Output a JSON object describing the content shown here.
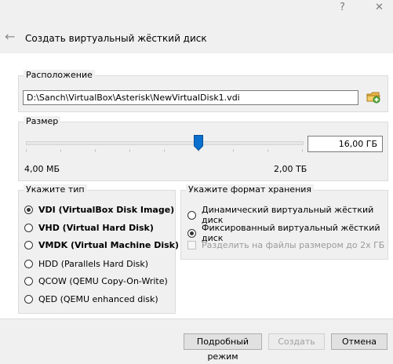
{
  "window": {
    "help": "?",
    "close": "✕"
  },
  "header": {
    "back": "←",
    "title": "Создать виртуальный жёсткий диск"
  },
  "location": {
    "label": "Расположение",
    "path": "D:\\Sanch\\VirtualBox\\Asterisk\\NewVirtualDisk1.vdi",
    "folder_icon": "folder-icon"
  },
  "size": {
    "label": "Размер",
    "value": "16,00 ГБ",
    "min_label": "4,00 МБ",
    "max_label": "2,00 ТБ"
  },
  "type": {
    "label": "Укажите тип",
    "options": [
      {
        "label": "VDI (VirtualBox Disk Image)",
        "selected": true,
        "bold": true
      },
      {
        "label": "VHD (Virtual Hard Disk)",
        "selected": false,
        "bold": true
      },
      {
        "label": "VMDK (Virtual Machine Disk)",
        "selected": false,
        "bold": true
      },
      {
        "label": "HDD (Parallels Hard Disk)",
        "selected": false,
        "bold": false
      },
      {
        "label": "QCOW (QEMU Copy-On-Write)",
        "selected": false,
        "bold": false
      },
      {
        "label": "QED (QEMU enhanced disk)",
        "selected": false,
        "bold": false
      }
    ]
  },
  "storage": {
    "label": "Укажите формат хранения",
    "options": [
      {
        "label": "Динамический виртуальный жёсткий диск",
        "selected": false
      },
      {
        "label": "Фиксированный виртуальный жёсткий диск",
        "selected": true
      }
    ],
    "split_label": "Разделить на файлы размером до 2х ГБ"
  },
  "buttons": {
    "expert": "Подробный режим",
    "create": "Создать",
    "cancel": "Отмена"
  }
}
